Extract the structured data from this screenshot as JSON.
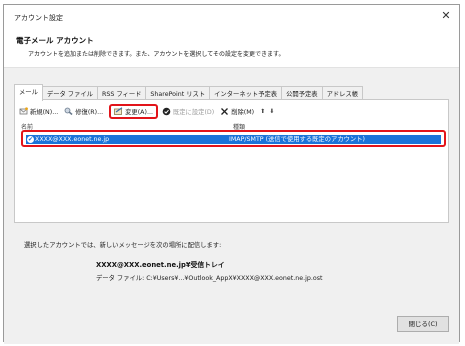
{
  "window": {
    "title": "アカウント設定",
    "close_glyph": "✕"
  },
  "header": {
    "title": "電子メール アカウント",
    "description": "アカウントを追加または削除できます。また、アカウントを選択してその設定を変更できます。"
  },
  "tabs": [
    {
      "label": "メール",
      "active": true
    },
    {
      "label": "データ ファイル"
    },
    {
      "label": "RSS フィード"
    },
    {
      "label": "SharePoint リスト"
    },
    {
      "label": "インターネット予定表"
    },
    {
      "label": "公開予定表"
    },
    {
      "label": "アドレス帳"
    }
  ],
  "toolbar": {
    "new_label": "新規(N)...",
    "repair_label": "修復(R)...",
    "change_label": "変更(A)...",
    "default_label": "既定に設定(D)",
    "remove_label": "削除(M)",
    "up_glyph": "⬆",
    "down_glyph": "⬇"
  },
  "accounts_table": {
    "headers": [
      "名前",
      "種類"
    ],
    "rows": [
      {
        "name": "XXXX@XXX.eonet.ne.jp",
        "type": "IMAP/SMTP (送信で使用する既定のアカウント)",
        "selected": true
      }
    ]
  },
  "delivery": {
    "description": "選択したアカウントでは、新しいメッセージを次の場所に配信します:",
    "folder": "XXXX@XXX.eonet.ne.jp¥受信トレイ",
    "data_file": "データ ファイル: C:¥Users¥...¥Outlook_AppX¥XXXX@XXX.eonet.ne.jp.ost"
  },
  "footer": {
    "close_label": "閉じる(C)"
  },
  "colors": {
    "highlight": "#e2141a",
    "selection": "#1a73d9"
  }
}
